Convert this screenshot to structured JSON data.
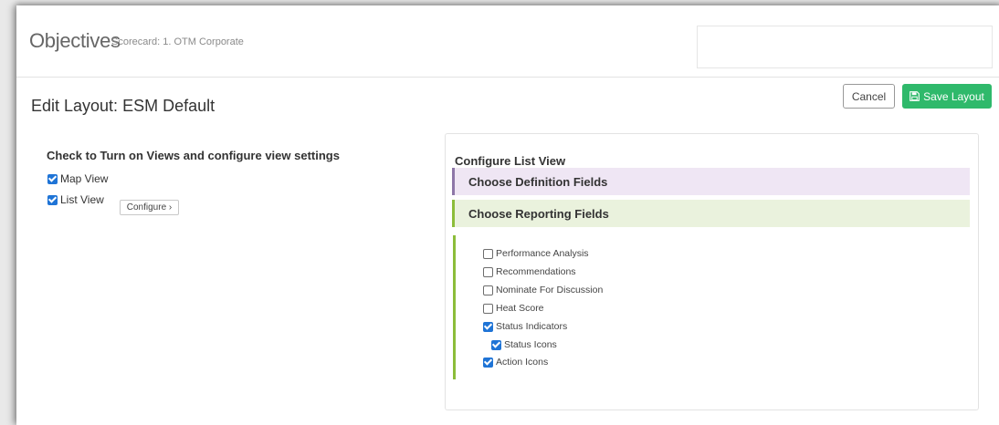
{
  "header": {
    "title": "Objectives",
    "subtitle": "Scorecard: 1. OTM Corporate"
  },
  "page": {
    "title": "Edit Layout: ESM Default"
  },
  "actions": {
    "cancel_label": "Cancel",
    "save_label": "Save Layout",
    "save_icon": "floppy-disk-icon"
  },
  "views": {
    "heading": "Check to Turn on Views and configure view settings",
    "items": [
      {
        "label": "Map View",
        "checked": true
      },
      {
        "label": "List View",
        "checked": true
      }
    ],
    "configure_label": "Configure ›"
  },
  "list_view_config": {
    "title": "Configure List View",
    "definition_section": "Choose Definition Fields",
    "reporting_section": "Choose Reporting Fields",
    "fields": [
      {
        "label": "Performance Analysis",
        "checked": false
      },
      {
        "label": "Recommendations",
        "checked": false
      },
      {
        "label": "Nominate For Discussion",
        "checked": false
      },
      {
        "label": "Heat Score",
        "checked": false
      },
      {
        "label": "Status Indicators",
        "checked": true
      },
      {
        "label": "Status Icons",
        "checked": true
      },
      {
        "label": "Action Icons",
        "checked": true
      }
    ]
  },
  "colors": {
    "save_button": "#2fb96b",
    "definition_bar": "#efe6f4",
    "definition_accent": "#8e77a8",
    "reporting_bar": "#eaf2dd",
    "reporting_accent": "#8cbd3a",
    "checkbox_on": "#1f74d6"
  }
}
